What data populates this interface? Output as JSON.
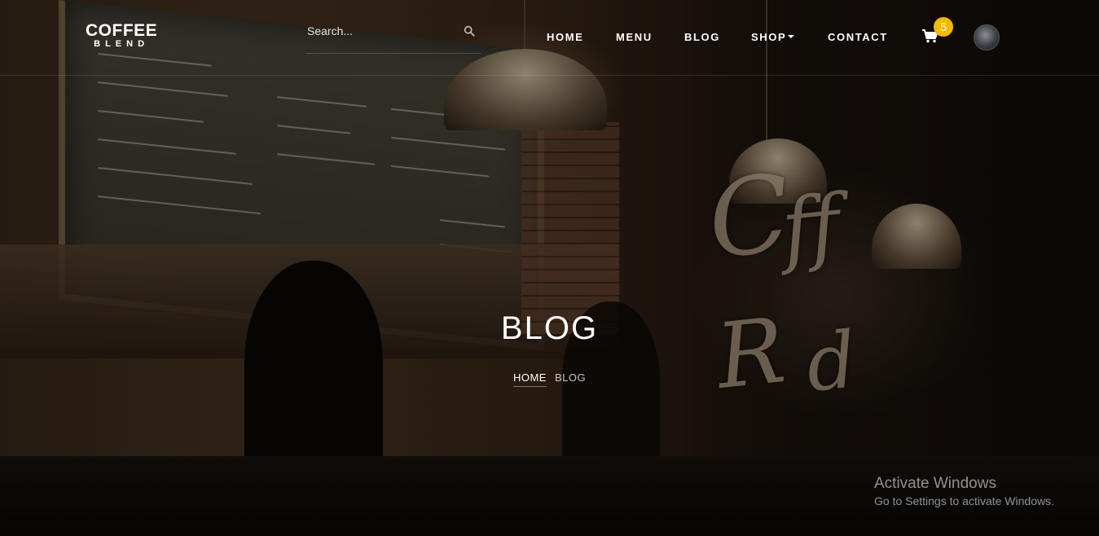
{
  "brand": {
    "name_top": "COFFEE",
    "name_bottom": "BLEND"
  },
  "search": {
    "placeholder": "Search...",
    "value": ""
  },
  "nav": {
    "items": [
      {
        "label": "HOME"
      },
      {
        "label": "MENU"
      },
      {
        "label": "BLOG"
      },
      {
        "label": "SHOP",
        "has_dropdown": true
      },
      {
        "label": "CONTACT"
      }
    ],
    "cart_count": "5"
  },
  "hero": {
    "title": "BLOG",
    "breadcrumb": {
      "home": "HOME",
      "current": "BLOG"
    }
  },
  "watermark": {
    "line1": "Activate Windows",
    "line2": "Go to Settings to activate Windows."
  },
  "colors": {
    "badge": "#f3b900",
    "text": "#ffffff"
  },
  "icons": {
    "search": "search-icon",
    "cart": "cart-icon",
    "caret": "caret-down-icon"
  }
}
